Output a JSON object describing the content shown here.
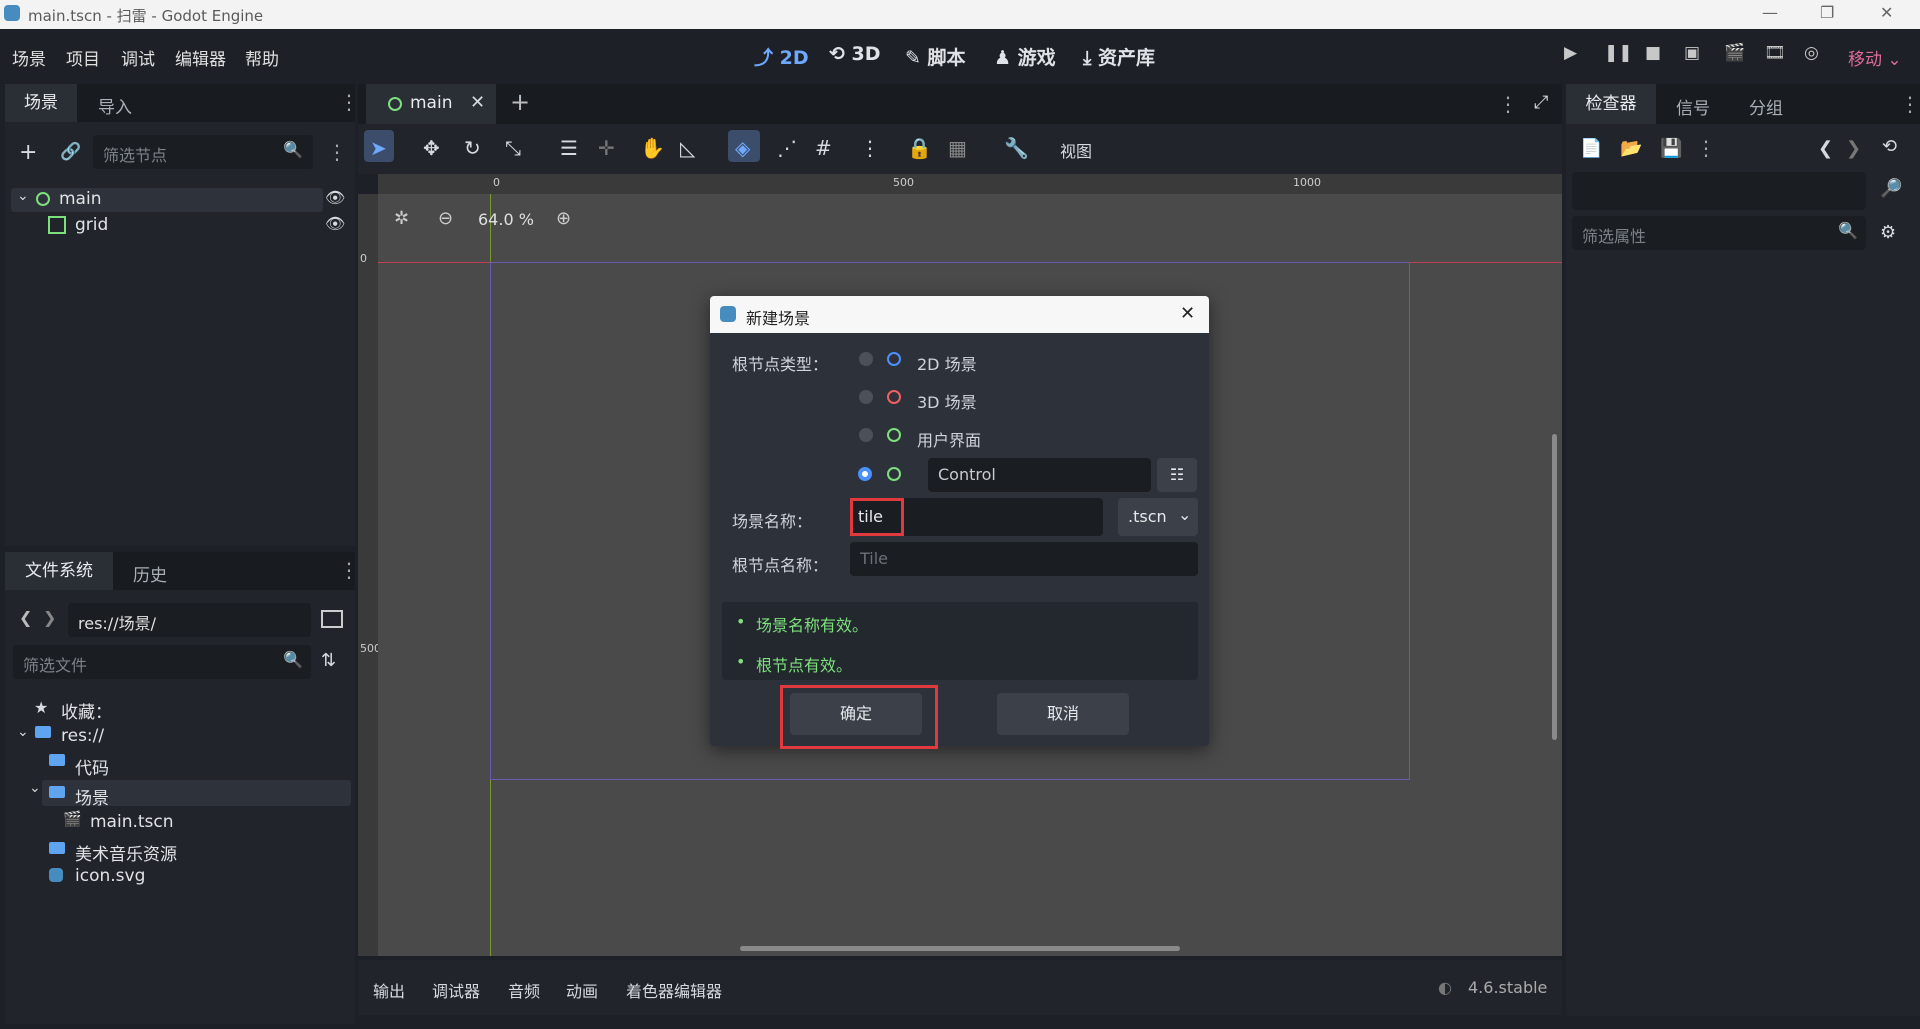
{
  "window": {
    "title": "main.tscn - 扫雷 - Godot Engine",
    "controls": [
      "—",
      "❐",
      "✕"
    ]
  },
  "menubar": {
    "items": [
      "场景",
      "项目",
      "调试",
      "编辑器",
      "帮助"
    ],
    "workspaces": [
      "2D",
      "3D",
      "脚本",
      "游戏",
      "资产库"
    ],
    "workspace_icons": [
      "⤴",
      "⟲",
      "✎",
      "♟",
      "⤓"
    ],
    "renderer": "移动"
  },
  "scene_dock": {
    "tabs": [
      "场景",
      "导入"
    ],
    "filter_placeholder": "筛选节点",
    "nodes": [
      {
        "name": "main",
        "icon": "control-node-icon"
      },
      {
        "name": "grid",
        "icon": "grid-container-icon"
      }
    ]
  },
  "filesystem_dock": {
    "tabs": [
      "文件系统",
      "历史"
    ],
    "path": "res://场景/",
    "filter_placeholder": "筛选文件",
    "items": [
      "收藏：",
      "res://",
      "代码",
      "场景",
      "main.tscn",
      "美术音乐资源",
      "icon.svg"
    ]
  },
  "editor": {
    "scene_tab": "main",
    "toolbar_view": "视图",
    "zoom": "64.0 %",
    "ruler_top": [
      "0",
      "500",
      "1000"
    ],
    "ruler_left": [
      "0",
      "500"
    ]
  },
  "bottom_panel": {
    "tabs": [
      "输出",
      "调试器",
      "音频",
      "动画",
      "着色器编辑器"
    ],
    "version": "4.6.stable"
  },
  "inspector": {
    "tabs": [
      "检查器",
      "信号",
      "分组"
    ],
    "filter_placeholder": "筛选属性"
  },
  "dialog": {
    "title": "新建场景",
    "root_type_label": "根节点类型：",
    "options": [
      "2D 场景",
      "3D 场景",
      "用户界面"
    ],
    "custom_type": "Control",
    "scene_name_label": "场景名称：",
    "scene_name_value": "tile",
    "extension": ".tscn",
    "root_name_label": "根节点名称：",
    "root_name_placeholder": "Tile",
    "messages": [
      "场景名称有效。",
      "根节点有效。"
    ],
    "confirm": "确定",
    "cancel": "取消"
  },
  "colors": {
    "accent": "#4a90ff",
    "valid": "#7de07d",
    "highlight": "#e0393e",
    "renderer": "#e06a9a"
  }
}
